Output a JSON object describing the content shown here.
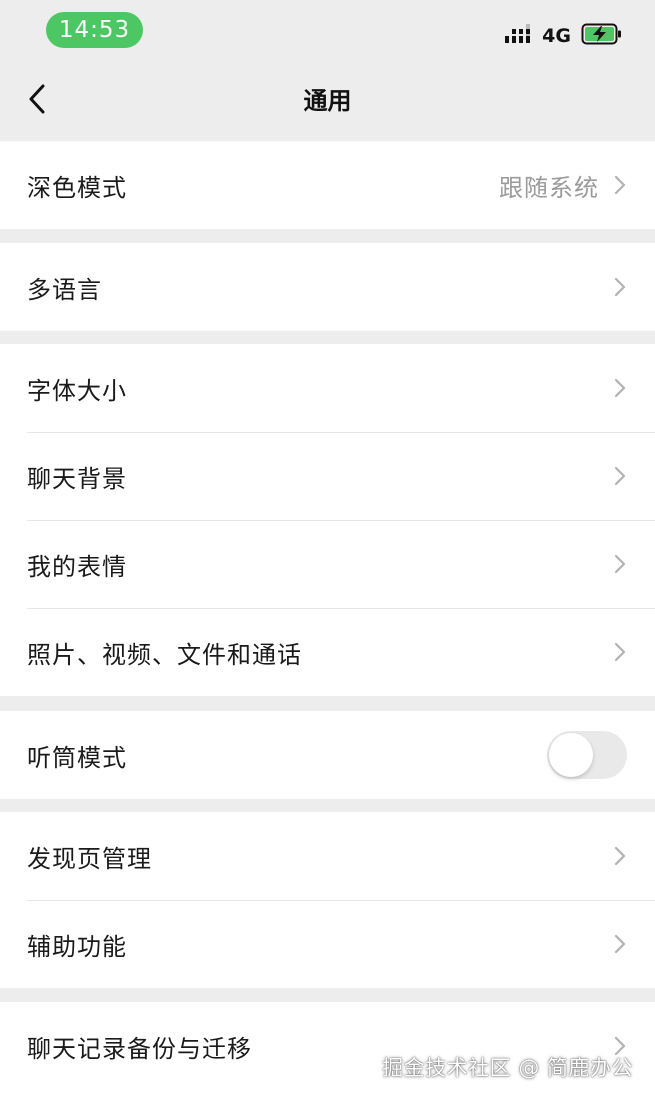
{
  "status_bar": {
    "time": "14:53",
    "network": "4G",
    "time_pill_color": "#4cc764",
    "battery_state": "charging"
  },
  "nav": {
    "title": "通用",
    "back_icon": "chevron-left-icon"
  },
  "groups": [
    {
      "items": [
        {
          "label": "深色模式",
          "value": "跟随系统"
        }
      ]
    },
    {
      "items": [
        {
          "label": "多语言"
        }
      ]
    },
    {
      "items": [
        {
          "label": "字体大小"
        },
        {
          "label": "聊天背景"
        },
        {
          "label": "我的表情"
        },
        {
          "label": "照片、视频、文件和通话"
        }
      ]
    },
    {
      "items": [
        {
          "label": "听筒模式",
          "toggle": false
        }
      ]
    },
    {
      "items": [
        {
          "label": "发现页管理"
        },
        {
          "label": "辅助功能"
        }
      ]
    },
    {
      "items": [
        {
          "label": "聊天记录备份与迁移"
        }
      ]
    }
  ],
  "watermark": "掘金技术社区 @ 简鹿办公"
}
